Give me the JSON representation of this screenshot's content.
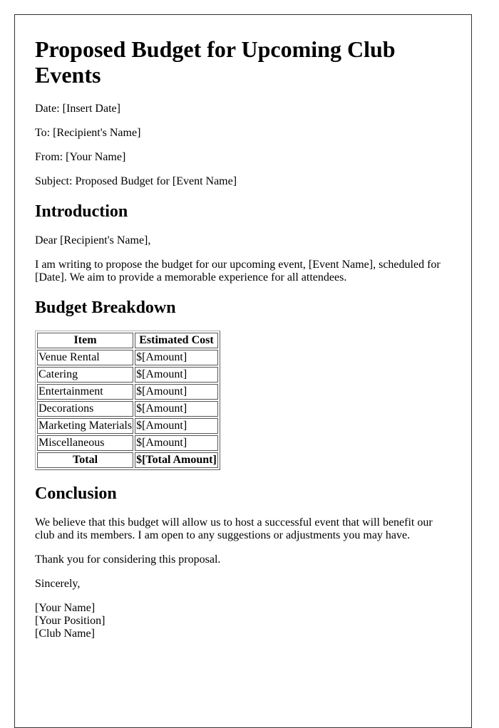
{
  "title": "Proposed Budget for Upcoming Club Events",
  "header_fields": [
    {
      "label": "Date:",
      "value": "[Insert Date]"
    },
    {
      "label": "To:",
      "value": "[Recipient's Name]"
    },
    {
      "label": "From:",
      "value": "[Your Name]"
    },
    {
      "label": "Subject:",
      "value": "Proposed Budget for [Event Name]"
    }
  ],
  "introduction": {
    "heading": "Introduction",
    "salutation": "Dear [Recipient's Name],",
    "body": "I am writing to propose the budget for our upcoming event, [Event Name], scheduled for [Date]. We aim to provide a memorable experience for all attendees."
  },
  "budget": {
    "heading": "Budget Breakdown",
    "columns": [
      "Item",
      "Estimated Cost"
    ],
    "rows": [
      {
        "item": "Venue Rental",
        "cost": "$[Amount]"
      },
      {
        "item": "Catering",
        "cost": "$[Amount]"
      },
      {
        "item": "Entertainment",
        "cost": "$[Amount]"
      },
      {
        "item": "Decorations",
        "cost": "$[Amount]"
      },
      {
        "item": "Marketing Materials",
        "cost": "$[Amount]"
      },
      {
        "item": "Miscellaneous",
        "cost": "$[Amount]"
      }
    ],
    "total": {
      "label": "Total",
      "cost": "$[Total Amount]"
    }
  },
  "conclusion": {
    "heading": "Conclusion",
    "body": "We believe that this budget will allow us to host a successful event that will benefit our club and its members. I am open to any suggestions or adjustments you may have.",
    "thanks": "Thank you for considering this proposal.",
    "closing": "Sincerely,",
    "signature": [
      "[Your Name]",
      "[Your Position]",
      "[Club Name]"
    ]
  }
}
